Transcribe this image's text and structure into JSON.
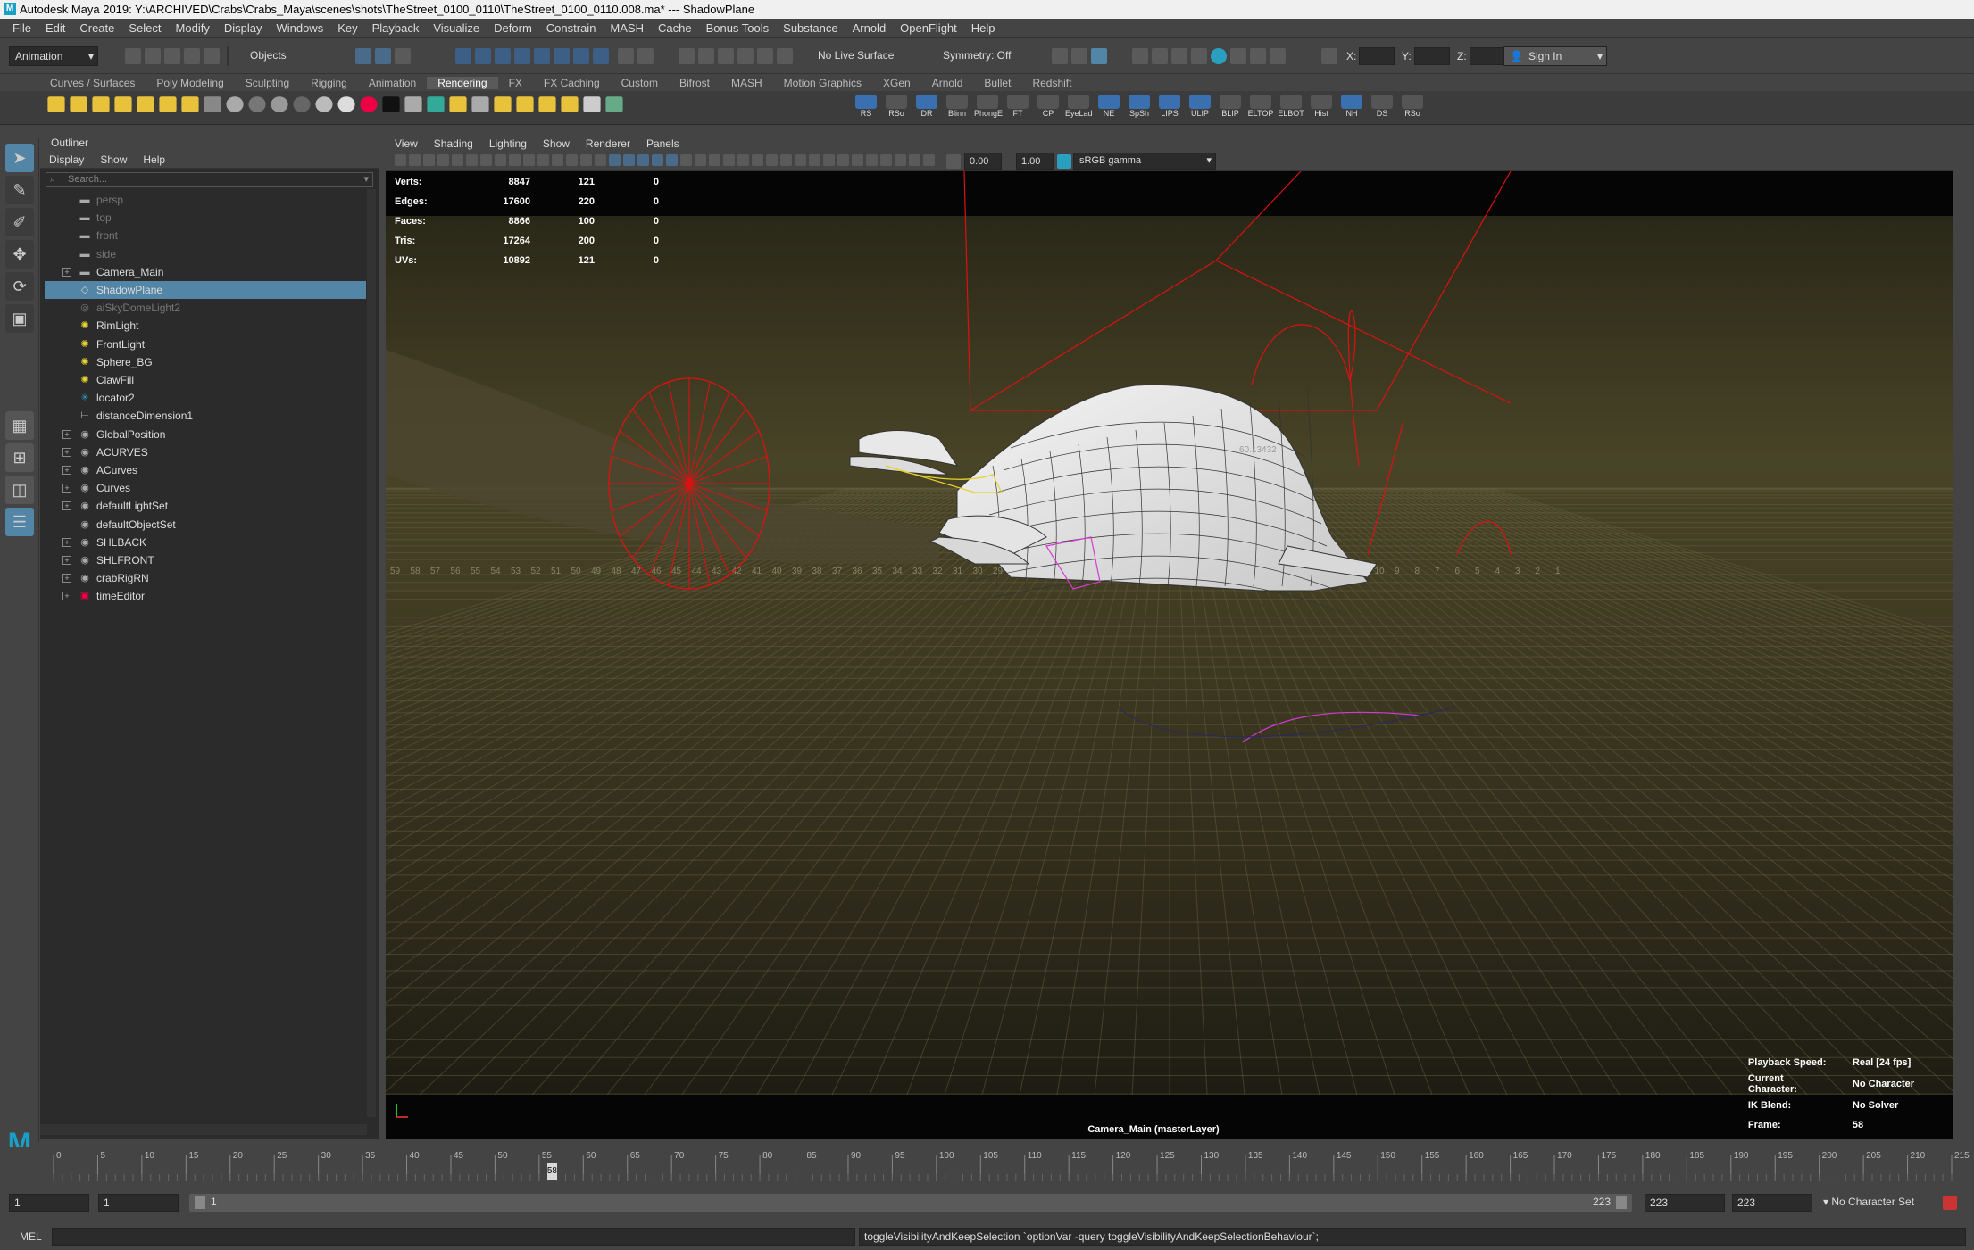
{
  "window": {
    "title": "Autodesk Maya 2019: Y:\\ARCHIVED\\Crabs\\Crabs_Maya\\scenes\\shots\\TheStreet_0100_0110\\TheStreet_0100_0110.008.ma*   ---   ShadowPlane",
    "logo": "M"
  },
  "menubar": [
    "File",
    "Edit",
    "Create",
    "Select",
    "Modify",
    "Display",
    "Windows",
    "Key",
    "Playback",
    "Visualize",
    "Deform",
    "Constrain",
    "MASH",
    "Cache",
    "Bonus Tools",
    "Substance",
    "Arnold",
    "OpenFlight",
    "Help"
  ],
  "status": {
    "menuset": "Animation",
    "selection_mode": "Objects",
    "live_surface": "No Live Surface",
    "symmetry": "Symmetry: Off",
    "x_label": "X:",
    "y_label": "Y:",
    "z_label": "Z:",
    "sign_in": "Sign In"
  },
  "shelf_tabs": [
    "Curves / Surfaces",
    "Poly Modeling",
    "Sculpting",
    "Rigging",
    "Animation",
    "Rendering",
    "FX",
    "FX Caching",
    "Custom",
    "Bifrost",
    "MASH",
    "Motion Graphics",
    "XGen",
    "Arnold",
    "Bullet",
    "Redshift"
  ],
  "shelf_active": "Rendering",
  "shelf_labels": [
    "RS",
    "RSo",
    "DR",
    "Blinn",
    "PhongE",
    "FT",
    "CP",
    "EyeLad",
    "NE",
    "SpSh",
    "LIPS",
    "ULIP",
    "BLIP",
    "ELTOP",
    "ELBOT",
    "Hist",
    "NH",
    "DS",
    "RSo"
  ],
  "outliner": {
    "title": "Outliner",
    "menu": [
      "Display",
      "Show",
      "Help"
    ],
    "search_placeholder": "Search...",
    "items": [
      {
        "label": "persp",
        "dim": true,
        "expand": false,
        "icon": "camera-icon"
      },
      {
        "label": "top",
        "dim": true,
        "expand": false,
        "icon": "camera-icon"
      },
      {
        "label": "front",
        "dim": true,
        "expand": false,
        "icon": "camera-icon"
      },
      {
        "label": "side",
        "dim": true,
        "expand": false,
        "icon": "camera-icon"
      },
      {
        "label": "Camera_Main",
        "dim": false,
        "expand": true,
        "icon": "camera-icon"
      },
      {
        "label": "ShadowPlane",
        "dim": false,
        "expand": false,
        "icon": "mesh-icon",
        "selected": true
      },
      {
        "label": "aiSkyDomeLight2",
        "dim": true,
        "expand": false,
        "icon": "skydome-icon"
      },
      {
        "label": "RimLight",
        "dim": false,
        "expand": false,
        "icon": "light-icon"
      },
      {
        "label": "FrontLight",
        "dim": false,
        "expand": false,
        "icon": "light-icon"
      },
      {
        "label": "Sphere_BG",
        "dim": false,
        "expand": false,
        "icon": "light-icon"
      },
      {
        "label": "ClawFill",
        "dim": false,
        "expand": false,
        "icon": "light-icon"
      },
      {
        "label": "locator2",
        "dim": false,
        "expand": false,
        "icon": "locator-icon"
      },
      {
        "label": "distanceDimension1",
        "dim": false,
        "expand": false,
        "icon": "dimension-icon"
      },
      {
        "label": "GlobalPosition",
        "dim": false,
        "expand": true,
        "icon": "curve-icon"
      },
      {
        "label": "ACURVES",
        "dim": false,
        "expand": true,
        "icon": "curve-icon"
      },
      {
        "label": "ACurves",
        "dim": false,
        "expand": true,
        "icon": "curve-icon"
      },
      {
        "label": "Curves",
        "dim": false,
        "expand": true,
        "icon": "curve-icon"
      },
      {
        "label": "defaultLightSet",
        "dim": false,
        "expand": true,
        "icon": "set-icon"
      },
      {
        "label": "defaultObjectSet",
        "dim": false,
        "expand": false,
        "icon": "set-icon"
      },
      {
        "label": "SHLBACK",
        "dim": false,
        "expand": true,
        "icon": "curve-icon"
      },
      {
        "label": "SHLFRONT",
        "dim": false,
        "expand": true,
        "icon": "curve-icon"
      },
      {
        "label": "crabRigRN",
        "dim": false,
        "expand": true,
        "icon": "reference-icon"
      },
      {
        "label": "timeEditor",
        "dim": false,
        "expand": true,
        "icon": "time-editor-icon"
      }
    ]
  },
  "viewport": {
    "menu": [
      "View",
      "Shading",
      "Lighting",
      "Show",
      "Renderer",
      "Panels"
    ],
    "exposure": "0.00",
    "gamma": "1.00",
    "colorspace": "sRGB gamma",
    "hud": [
      {
        "label": "Verts:",
        "a": "8847",
        "b": "121",
        "c": "0"
      },
      {
        "label": "Edges:",
        "a": "17600",
        "b": "220",
        "c": "0"
      },
      {
        "label": "Faces:",
        "a": "8866",
        "b": "100",
        "c": "0"
      },
      {
        "label": "Tris:",
        "a": "17264",
        "b": "200",
        "c": "0"
      },
      {
        "label": "UVs:",
        "a": "10892",
        "b": "121",
        "c": "0"
      }
    ],
    "hud_right": [
      {
        "label": "Playback Speed:",
        "value": "Real [24 fps]"
      },
      {
        "label": "Current Character:",
        "value": "No Character"
      },
      {
        "label": "IK Blend:",
        "value": "No Solver"
      },
      {
        "label": "Frame:",
        "value": "58"
      }
    ],
    "camera_label": "Camera_Main (masterLayer)",
    "floor_numbers": [
      "59",
      "58",
      "57",
      "56",
      "55",
      "54",
      "53",
      "52",
      "51",
      "50",
      "49",
      "48",
      "47",
      "46",
      "45",
      "44",
      "43",
      "42",
      "41",
      "40",
      "39",
      "38",
      "37",
      "36",
      "35",
      "34",
      "33",
      "32",
      "31",
      "30",
      "29",
      "28",
      "27",
      "26",
      "25",
      "24",
      "23",
      "22",
      "21",
      "20",
      "19",
      "18",
      "17",
      "16",
      "15",
      "14",
      "13",
      "12",
      "11",
      "10",
      "9",
      "8",
      "7",
      "6",
      "5",
      "4",
      "3",
      "2",
      "1"
    ],
    "mesh_label": "60.13432"
  },
  "timeline": {
    "ticks": [
      "0",
      "5",
      "10",
      "15",
      "20",
      "25",
      "30",
      "35",
      "40",
      "45",
      "50",
      "55",
      "60",
      "65",
      "70",
      "75",
      "80",
      "85",
      "90",
      "95",
      "100",
      "105",
      "110",
      "115",
      "120",
      "125",
      "130",
      "135",
      "140",
      "145",
      "150",
      "155",
      "160",
      "165",
      "170",
      "175",
      "180",
      "185",
      "190",
      "195",
      "200",
      "205",
      "210",
      "215"
    ],
    "current": "58",
    "current_frac": 0.2624
  },
  "range": {
    "start": "1",
    "start_inner": "1",
    "slider_start": "1",
    "slider_end": "223",
    "end_inner": "223",
    "end": "223",
    "character_set": "No Character Set"
  },
  "cmd": {
    "lang": "MEL",
    "result": "toggleVisibilityAndKeepSelection `optionVar -query toggleVisibilityAndKeepSelectionBehaviour`;"
  }
}
